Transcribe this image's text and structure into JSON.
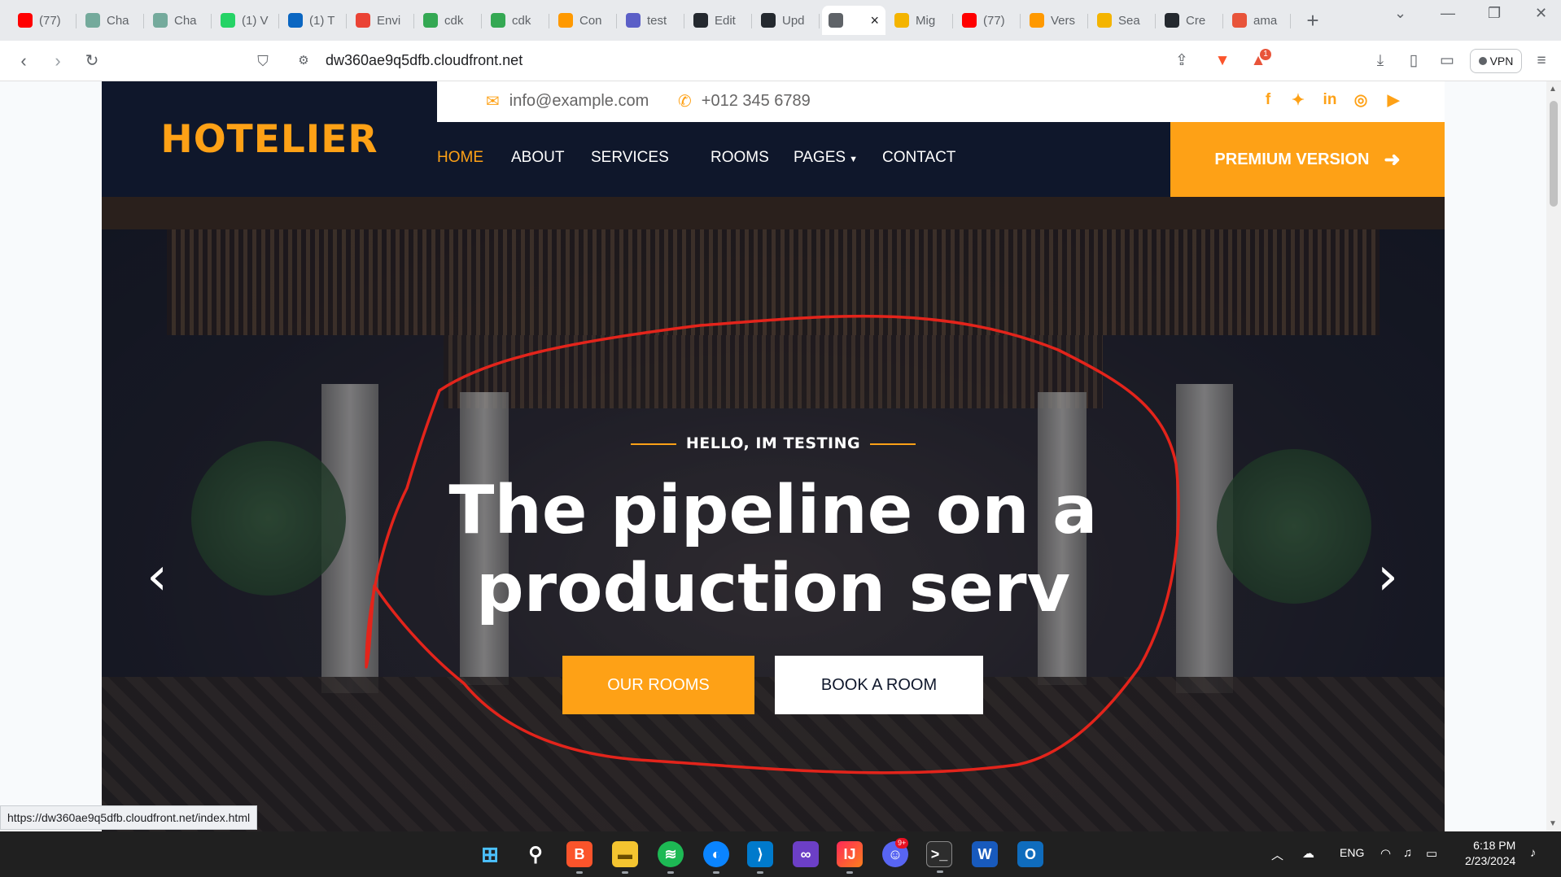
{
  "browser": {
    "tabs": [
      {
        "label": "(77)",
        "icon": "youtube-icon",
        "color": "#ff0000"
      },
      {
        "label": "Cha",
        "icon": "chatgpt-icon",
        "color": "#74aa9c"
      },
      {
        "label": "Cha",
        "icon": "chatgpt-icon",
        "color": "#74aa9c"
      },
      {
        "label": "(1) V",
        "icon": "whatsapp-icon",
        "color": "#25d366"
      },
      {
        "label": "(1) T",
        "icon": "linkedin-icon",
        "color": "#0a66c2"
      },
      {
        "label": "Envi",
        "icon": "gmail-icon",
        "color": "#ea4335"
      },
      {
        "label": "cdk",
        "icon": "google-drive-icon",
        "color": "#34a853"
      },
      {
        "label": "cdk",
        "icon": "google-drive-icon",
        "color": "#34a853"
      },
      {
        "label": "Con",
        "icon": "aws-icon",
        "color": "#ff9900"
      },
      {
        "label": "test",
        "icon": "calendar-icon",
        "color": "#5b5fc7"
      },
      {
        "label": "Edit",
        "icon": "github-icon",
        "color": "#24292f"
      },
      {
        "label": "Upd",
        "icon": "github-icon",
        "color": "#24292f"
      },
      {
        "label": "",
        "icon": "globe-icon",
        "color": "#5f6368",
        "active": true
      },
      {
        "label": "Mig",
        "icon": "box-icon",
        "color": "#f4b400"
      },
      {
        "label": "(77)",
        "icon": "youtube-icon",
        "color": "#ff0000"
      },
      {
        "label": "Vers",
        "icon": "aws-icon",
        "color": "#ff9900"
      },
      {
        "label": "Sea",
        "icon": "box-icon",
        "color": "#f4b400"
      },
      {
        "label": "Cre",
        "icon": "github-icon",
        "color": "#24292f"
      },
      {
        "label": "ama",
        "icon": "shield-icon",
        "color": "#e8543a"
      }
    ],
    "url": "dw360ae9q5dfb.cloudfront.net",
    "vpn_label": "VPN",
    "status_url": "https://dw360ae9q5dfb.cloudfront.net/index.html",
    "notification_count": "1"
  },
  "site": {
    "brand": "HOTELIER",
    "email": "info@example.com",
    "phone": "+012 345 6789",
    "nav": [
      {
        "label": "HOME",
        "active": true
      },
      {
        "label": "ABOUT"
      },
      {
        "label": "SERVICES"
      },
      {
        "label": "ROOMS"
      },
      {
        "label": "PAGES"
      },
      {
        "label": "CONTACT"
      }
    ],
    "premium": "PREMIUM VERSION",
    "hero": {
      "subtitle": "HELLO, IM TESTING",
      "title_line1": "The pipeline on a",
      "title_line2": "production serv",
      "btn_primary": "OUR ROOMS",
      "btn_secondary": "BOOK A ROOM"
    },
    "accent_color": "#fea116",
    "dark_color": "#0f172b"
  },
  "taskbar": {
    "lang": "ENG",
    "time": "6:18 PM",
    "date": "2/23/2024",
    "discord_badge": "9+"
  }
}
